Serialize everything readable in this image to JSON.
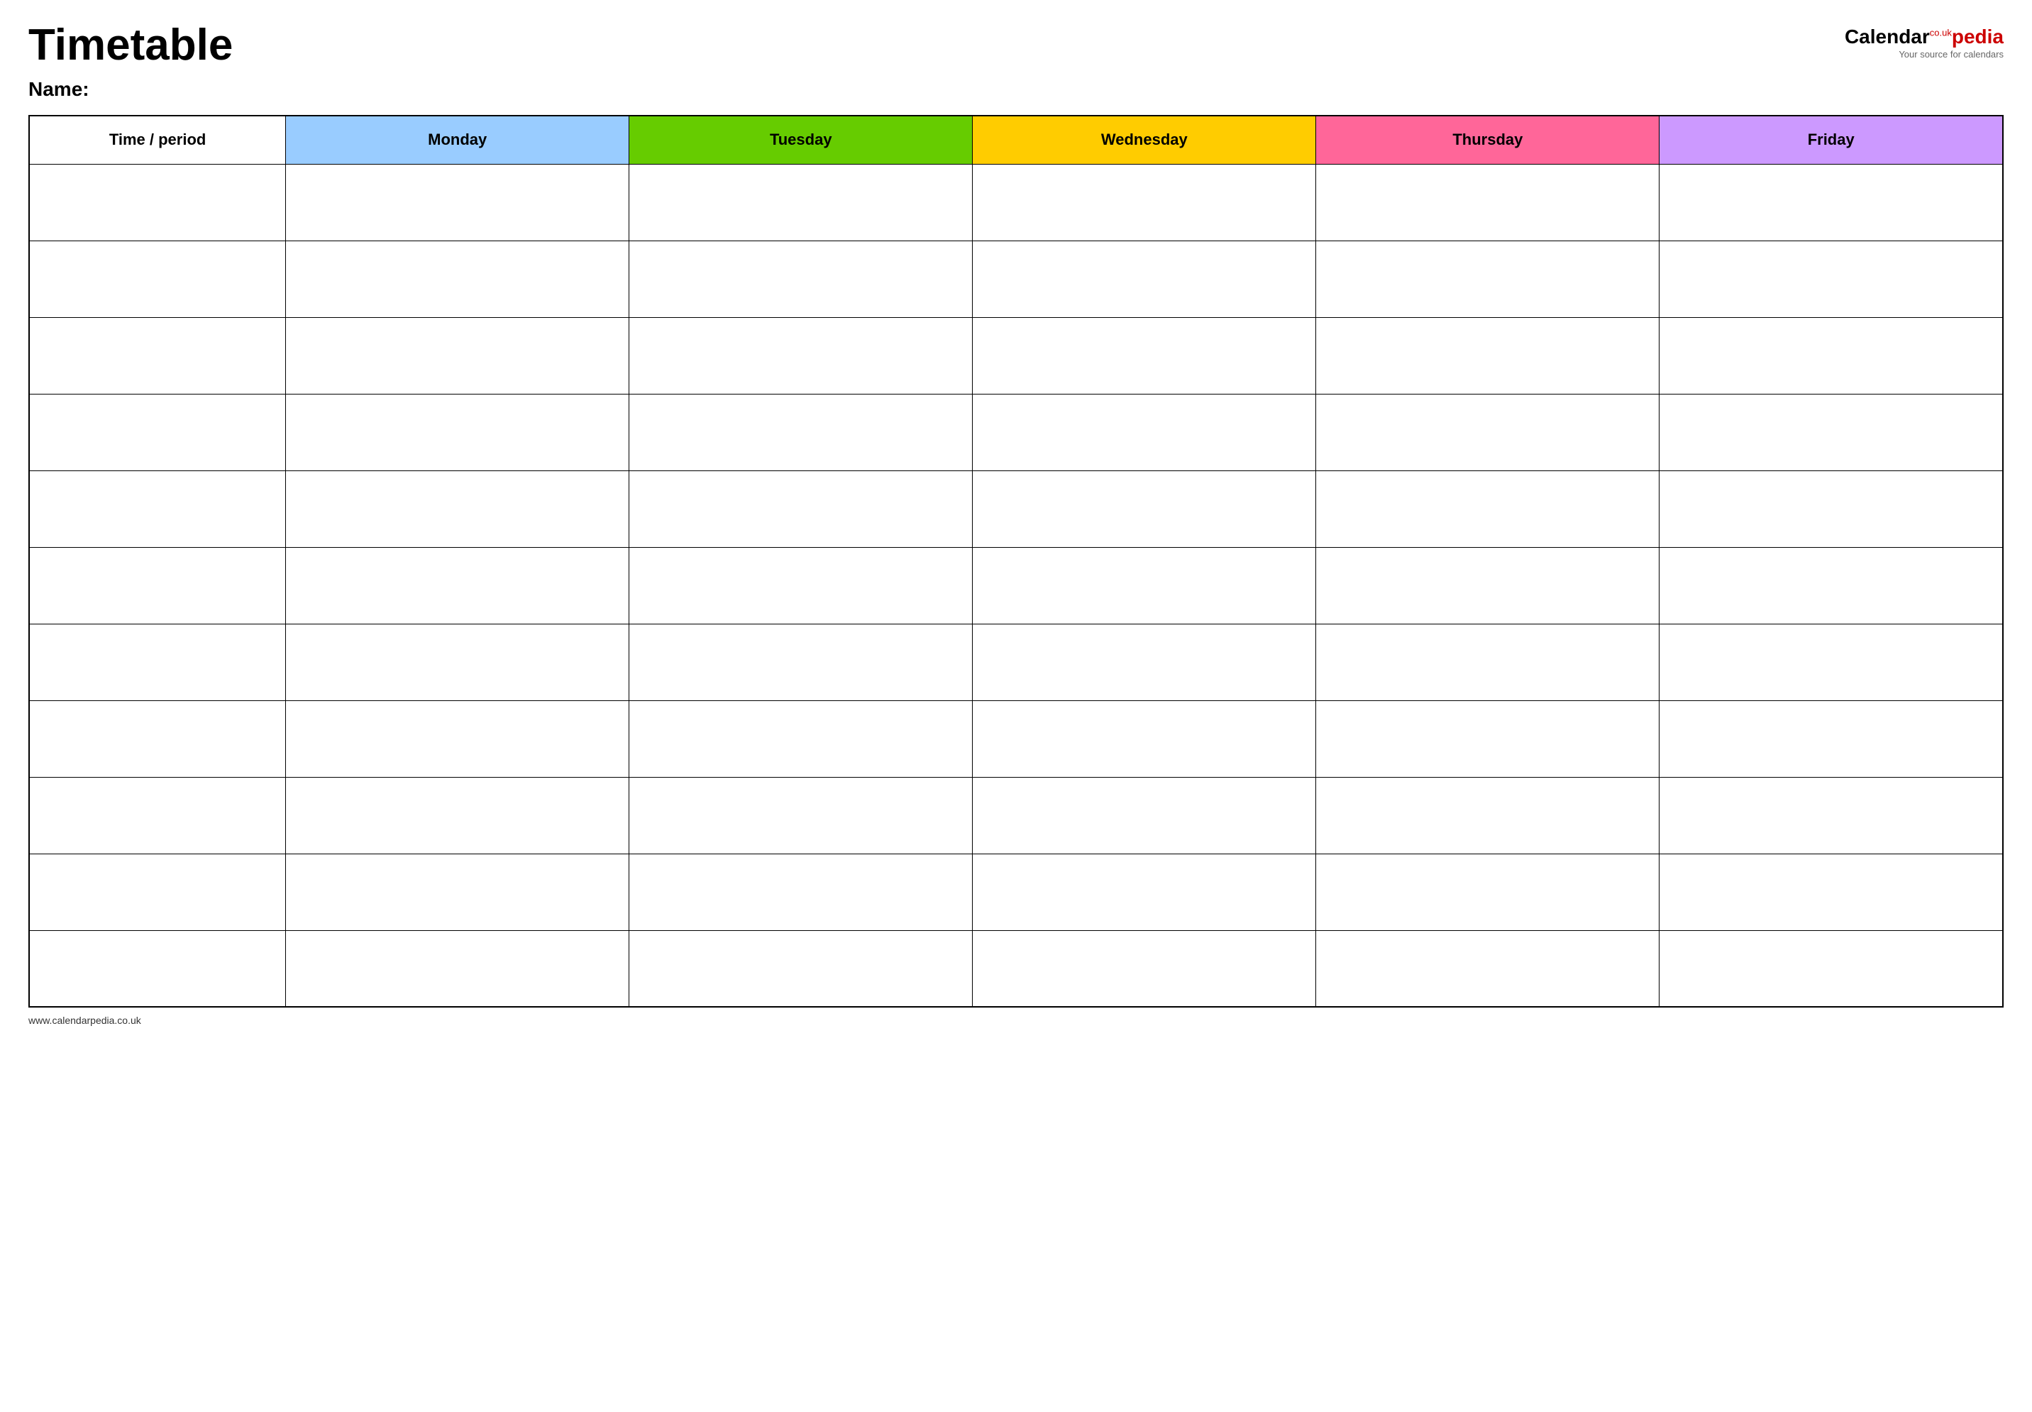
{
  "header": {
    "title": "Timetable",
    "name_label": "Name:",
    "logo": {
      "calendar_part": "Calendar",
      "couk": "co.uk",
      "pedia_part": "pedia",
      "subtitle": "Your source for calendars"
    }
  },
  "table": {
    "columns": [
      {
        "key": "time",
        "label": "Time / period",
        "bg": "#ffffff"
      },
      {
        "key": "monday",
        "label": "Monday",
        "bg": "#99ccff"
      },
      {
        "key": "tuesday",
        "label": "Tuesday",
        "bg": "#66cc00"
      },
      {
        "key": "wednesday",
        "label": "Wednesday",
        "bg": "#ffcc00"
      },
      {
        "key": "thursday",
        "label": "Thursday",
        "bg": "#ff6699"
      },
      {
        "key": "friday",
        "label": "Friday",
        "bg": "#cc99ff"
      }
    ],
    "row_count": 11
  },
  "footer": {
    "url": "www.calendarpedia.co.uk"
  }
}
